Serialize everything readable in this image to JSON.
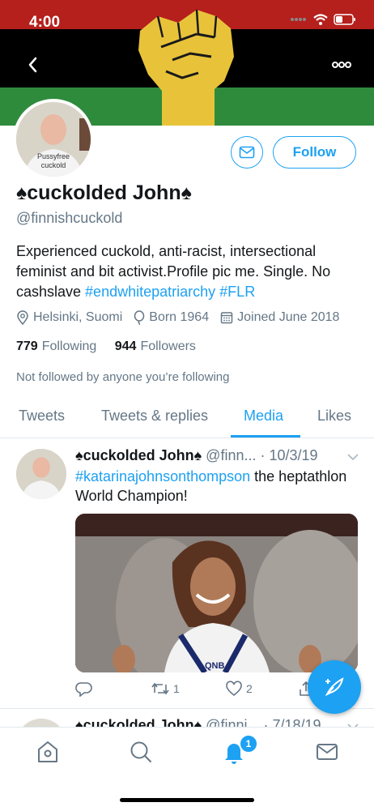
{
  "status_bar": {
    "time": "4:00"
  },
  "profile": {
    "display_name": "♠cuckolded John♠",
    "handle": "@finnishcuckold",
    "avatar_shirt_text": [
      "Pussyfree",
      "cuckold"
    ],
    "follow_label": "Follow",
    "bio_text": "Experienced cuckold, anti-racist, intersectional feminist and bit activist.Profile pic me. Single. No cashslave ",
    "bio_hashtags": [
      "#endwhitepatriarchy",
      "#FLR"
    ],
    "location": "Helsinki, Suomi",
    "born": "Born 1964",
    "joined": "Joined June 2018",
    "following_count": "779",
    "following_label": "Following",
    "followers_count": "944",
    "followers_label": "Followers",
    "not_followed_text": "Not followed by anyone you’re following"
  },
  "tabs": [
    {
      "label": "Tweets"
    },
    {
      "label": "Tweets & replies"
    },
    {
      "label": "Media",
      "active": true
    },
    {
      "label": "Likes"
    }
  ],
  "tweet": {
    "author": "♠cuckolded John♠",
    "handle": "@finn...",
    "date": "· 10/3/19",
    "hashtag": "#katarinajohnsonthompson",
    "text_rest": " the heptathlon World Champion!",
    "media_sponsor": "QNB",
    "replies": "",
    "retweets": "1",
    "likes": "2"
  },
  "next_tweet": {
    "author": "♠cuckolded John♠",
    "handle": "@finni...",
    "date": "· 7/18/19"
  },
  "bottom_nav": {
    "notifications_badge": "1"
  },
  "colors": {
    "accent": "#1da1f2",
    "banner_red": "#b51f1c",
    "banner_black": "#000000",
    "banner_green": "#2e8b3c",
    "fist_yellow": "#e8c33a"
  }
}
